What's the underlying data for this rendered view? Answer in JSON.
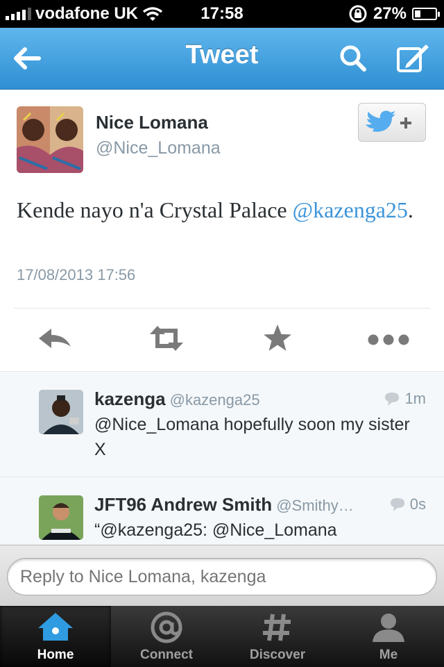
{
  "status_bar": {
    "carrier": "vodafone UK",
    "time": "17:58",
    "battery": "27%",
    "battery_level": 0.27
  },
  "nav": {
    "title": "Tweet"
  },
  "tweet": {
    "author_name": "Nice Lomana",
    "author_handle": "@Nice_Lomana",
    "text": "Kende nayo n'a Crystal Palace ",
    "mention": "@kazenga25",
    "text_end": ".",
    "timestamp": "17/08/2013 17:56"
  },
  "replies": [
    {
      "name": "kazenga",
      "handle": "@kazenga25",
      "time": "1m",
      "text": "@Nice_Lomana hopefully soon my sister X"
    },
    {
      "name": "JFT96 Andrew Smith",
      "handle": "@Smithy…",
      "time": "0s",
      "text": "“@kazenga25: @Nice_Lomana"
    }
  ],
  "reply_bar": {
    "placeholder": "Reply to Nice Lomana, kazenga"
  },
  "tabs": [
    {
      "label": "Home",
      "icon": "home-icon",
      "active": true
    },
    {
      "label": "Connect",
      "icon": "at-icon",
      "active": false
    },
    {
      "label": "Discover",
      "icon": "hash-icon",
      "active": false
    },
    {
      "label": "Me",
      "icon": "person-icon",
      "active": false
    }
  ],
  "colors": {
    "twitter_blue": "#2f8fd3",
    "mention": "#3b94d9",
    "bird": "#55acee"
  }
}
